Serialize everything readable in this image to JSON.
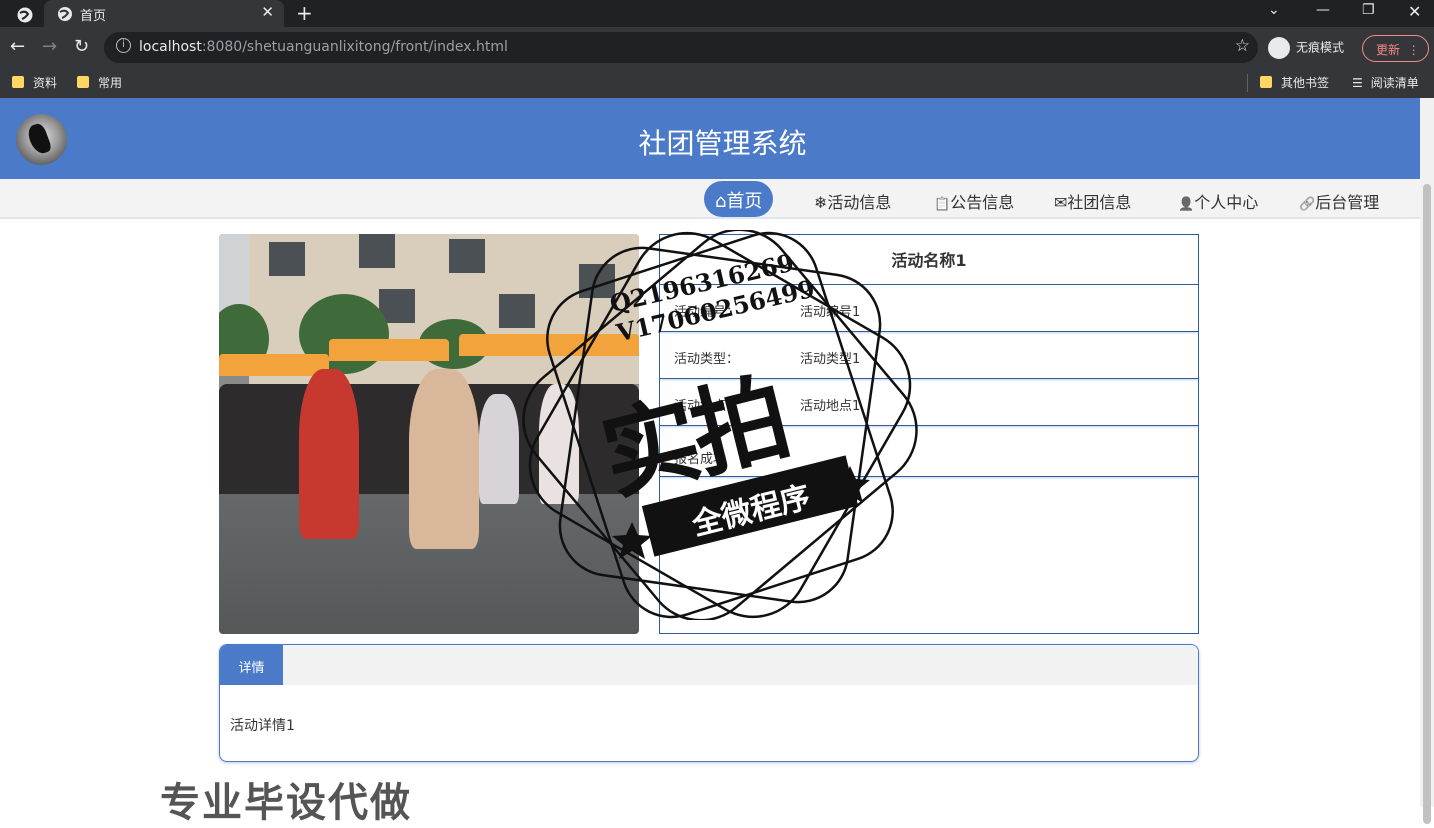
{
  "browser": {
    "tab_title": "首页",
    "url_host": "localhost",
    "url_rest": ":8080/shetuanguanlixitong/front/index.html",
    "incognito_label": "无痕模式",
    "update_label": "更新",
    "bookmarks": [
      "资料",
      "常用"
    ],
    "bookmarks_right": [
      "其他书签",
      "阅读清单"
    ]
  },
  "site": {
    "title": "社团管理系统",
    "nav": [
      {
        "icon": "⌂",
        "label": "首页",
        "active": true
      },
      {
        "icon": "❄",
        "label": "活动信息"
      },
      {
        "icon": "📋",
        "label": "公告信息"
      },
      {
        "icon": "✉",
        "label": "社团信息"
      },
      {
        "icon": "👤",
        "label": "个人中心"
      },
      {
        "icon": "🔗",
        "label": "后台管理"
      }
    ]
  },
  "activity": {
    "name": "活动名称1",
    "rows": [
      {
        "label": "活动编号：",
        "value": "活动编号1"
      },
      {
        "label": "活动类型：",
        "value": "活动类型1"
      },
      {
        "label": "活动地点：",
        "value": "活动地点1"
      },
      {
        "label": "报名成功",
        "value": ""
      }
    ]
  },
  "detail": {
    "tab_label": "详情",
    "text": "活动详情1"
  },
  "watermark": {
    "contact_1": "Q2196316269",
    "contact_2": "V17060256499",
    "big": "实拍",
    "ribbon": "全微程序",
    "bottom": "专业毕设代做"
  },
  "colors": {
    "header": "#4a7ac8",
    "border": "#2f5b9a"
  }
}
